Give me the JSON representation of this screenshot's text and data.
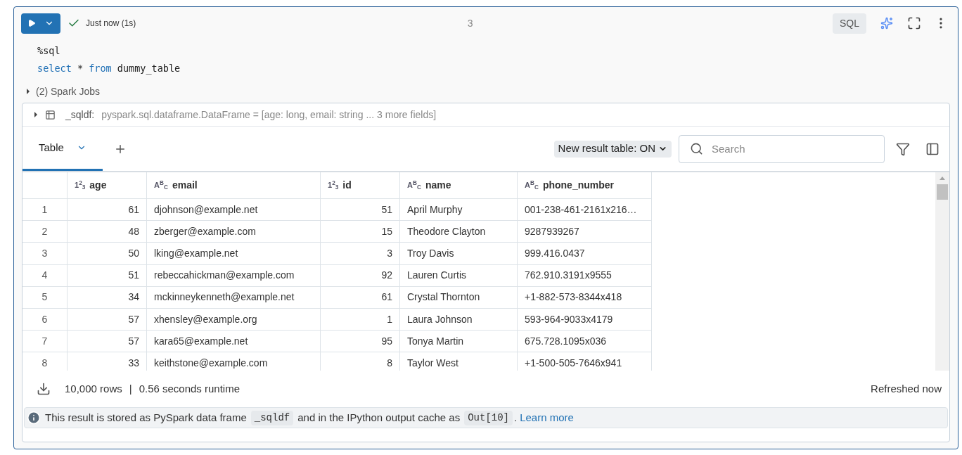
{
  "cell": {
    "status": "Just now (1s)",
    "succeeded": true,
    "cell_number": "3",
    "language": "SQL",
    "code": [
      [
        {
          "text": "%sql",
          "kind": "plain"
        }
      ],
      [
        {
          "text": "select",
          "kind": "keyword"
        },
        {
          "text": " * ",
          "kind": "plain"
        },
        {
          "text": "from",
          "kind": "keyword"
        },
        {
          "text": " dummy_table",
          "kind": "plain"
        }
      ]
    ]
  },
  "spark_jobs": {
    "label": "(2) Spark Jobs",
    "expanded": false
  },
  "dataframe": {
    "name": "_sqldf:",
    "schema": "pyspark.sql.dataframe.DataFrame = [age: long, email: string ... 3 more fields]",
    "expanded": false
  },
  "tabs": [
    {
      "label": "Table",
      "selected": true
    }
  ],
  "toggle": {
    "label": "New result table: ON"
  },
  "search": {
    "placeholder": "Search"
  },
  "table": {
    "columns": [
      {
        "label": "age",
        "kind": "number",
        "type_icon": "1$^{2}$$_{3}$"
      },
      {
        "label": "email",
        "kind": "string",
        "type_icon": "A$^{B}$$_{C}$"
      },
      {
        "label": "id",
        "kind": "number",
        "type_icon": "1$^{2}$$_{3}$"
      },
      {
        "label": "name",
        "kind": "string",
        "type_icon": "A$^{B}$$_{C}$"
      },
      {
        "label": "phone_number",
        "kind": "string",
        "type_icon": "A$^{B}$$_{C}$"
      }
    ],
    "rows": [
      {
        "index": "1",
        "cells": [
          "61",
          "djohnson@example.net",
          "51",
          "April Murphy",
          "001-238-461-2161x216…"
        ]
      },
      {
        "index": "2",
        "cells": [
          "48",
          "zberger@example.com",
          "15",
          "Theodore Clayton",
          "9287939267"
        ]
      },
      {
        "index": "3",
        "cells": [
          "50",
          "lking@example.net",
          "3",
          "Troy Davis",
          "999.416.0437"
        ]
      },
      {
        "index": "4",
        "cells": [
          "51",
          "rebeccahickman@example.com",
          "92",
          "Lauren Curtis",
          "762.910.3191x9555"
        ]
      },
      {
        "index": "5",
        "cells": [
          "34",
          "mckinneykenneth@example.net",
          "61",
          "Crystal Thornton",
          "+1-882-573-8344x418"
        ]
      },
      {
        "index": "6",
        "cells": [
          "57",
          "xhensley@example.org",
          "1",
          "Laura Johnson",
          "593-964-9033x4179"
        ]
      },
      {
        "index": "7",
        "cells": [
          "57",
          "kara65@example.net",
          "95",
          "Tonya Martin",
          "675.728.1095x036"
        ]
      },
      {
        "index": "8",
        "cells": [
          "33",
          "keithstone@example.com",
          "8",
          "Taylor West",
          "+1-500-505-7646x941"
        ]
      }
    ]
  },
  "footer": {
    "rows": "10,000 rows",
    "separator": "|",
    "runtime": "0.56 seconds runtime",
    "refreshed": "Refreshed now"
  },
  "info": {
    "text_before": "This result is stored as PySpark data frame",
    "code_1": "_sqldf",
    "text_middle": "and in the IPython output cache as",
    "code_2": "Out[10]",
    "text_after": ".",
    "link": "Learn more"
  }
}
